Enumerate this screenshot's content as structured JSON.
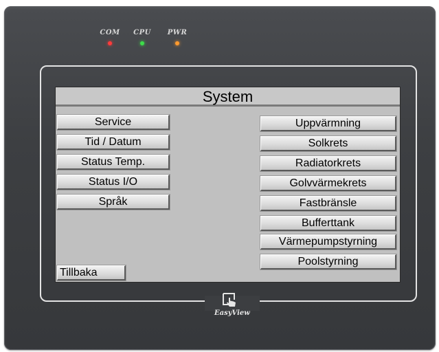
{
  "indicators": [
    {
      "label": "COM",
      "color": "#ff3b3b"
    },
    {
      "label": "CPU",
      "color": "#3ddc4a"
    },
    {
      "label": "PWR",
      "color": "#ff9a2e"
    }
  ],
  "screen": {
    "title": "System",
    "left_buttons": [
      "Service",
      "Tid / Datum",
      "Status Temp.",
      "Status I/O",
      "Språk"
    ],
    "right_buttons": [
      "Uppvärmning",
      "Solkrets",
      "Radiatorkrets",
      "Golvvärmekrets",
      "Fastbränsle",
      "Bufferttank",
      "Värmepumpstyrning",
      "Poolstyrning"
    ],
    "back_button": "Tillbaka"
  },
  "brand": {
    "logo_icon": "touch-hand-icon",
    "name": "EasyView"
  }
}
